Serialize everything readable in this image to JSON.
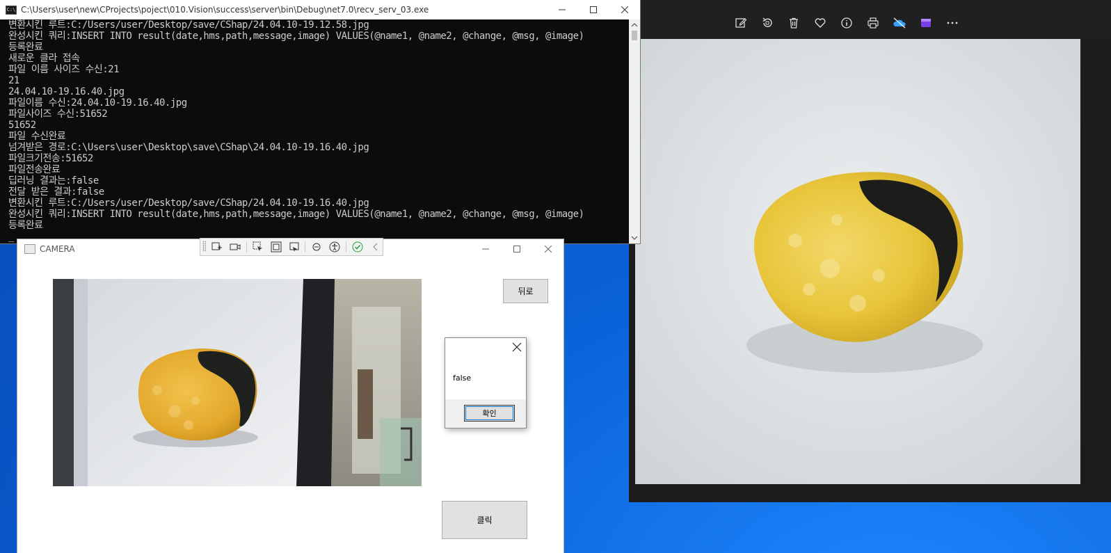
{
  "console": {
    "title": "C:\\Users\\user\\new\\CProjects\\poject\\010.Vision\\success\\server\\bin\\Debug\\net7.0\\recv_serv_03.exe",
    "icon_text": "C:\\",
    "lines": [
      "변환시킨 루트:C:/Users/user/Desktop/save/CShap/24.04.10-19.12.58.jpg",
      "완성시킨 쿼리:INSERT INTO result(date,hms,path,message,image) VALUES(@name1, @name2, @change, @msg, @image)",
      "등록완료",
      "새로운 클라 접속",
      "파일 이름 사이즈 수신:21",
      "21",
      "24.04.10-19.16.40.jpg",
      "파일이름 수신:24.04.10-19.16.40.jpg",
      "파일사이즈 수신:51652",
      "51652",
      "파일 수신완료",
      "넘겨받은 경로:C:\\Users\\user\\Desktop\\save\\CShap\\24.04.10-19.16.40.jpg",
      "파일크기전송:51652",
      "파일전송완료",
      "딥러닝 결과는:false",
      "전달 받은 결과:false",
      "변환시킨 루트:C:/Users/user/Desktop/save/CShap/24.04.10-19.16.40.jpg",
      "완성시킨 쿼리:INSERT INTO result(date,hms,path,message,image) VALUES(@name1, @name2, @change, @msg, @image)",
      "등록완료",
      "_"
    ]
  },
  "camera": {
    "title": "CAMERA",
    "back_label": "뒤로",
    "click_label": "클릭"
  },
  "msgbox": {
    "text": "false",
    "ok_label": "확인"
  },
  "photos": {
    "toolbar_icons": [
      "edit-icon",
      "rotate-icon",
      "delete-icon",
      "favorite-icon",
      "info-icon",
      "print-icon",
      "onedrive-icon",
      "clipchamp-icon",
      "more-icon"
    ]
  },
  "colors": {
    "console_bg": "#0c0c0c",
    "console_text": "#cccccc",
    "chip_yellow": "#e8c53a",
    "seaweed": "#1c1c1a",
    "desktop_blue": "#0a63d8"
  }
}
